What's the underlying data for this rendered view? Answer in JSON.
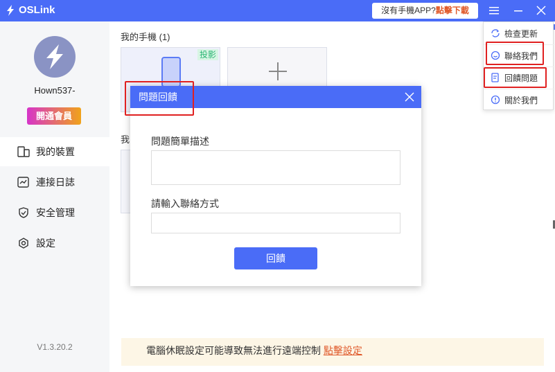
{
  "titlebar": {
    "app_name": "OSLink",
    "download_prompt": "沒有手機APP?",
    "download_link": "點擊下載"
  },
  "sidebar": {
    "username": "Hown537-",
    "vip_label": "開通會員",
    "items": [
      {
        "label": "我的裝置",
        "icon": "device-icon"
      },
      {
        "label": "連接日誌",
        "icon": "log-icon"
      },
      {
        "label": "安全管理",
        "icon": "shield-icon"
      },
      {
        "label": "設定",
        "icon": "gear-icon"
      }
    ],
    "version": "V1.3.20.2"
  },
  "main": {
    "my_phones_title": "我的手機 (1)",
    "cast_tag": "投影",
    "second_title_partial": "我",
    "notice_text": "電腦休眠設定可能導致無法進行遠端控制",
    "notice_link": "點擊設定"
  },
  "menu": {
    "items": [
      {
        "label": "檢查更新",
        "icon": "refresh-icon"
      },
      {
        "label": "聯絡我們",
        "icon": "chat-icon"
      },
      {
        "label": "回饋問題",
        "icon": "feedback-icon"
      },
      {
        "label": "關於我們",
        "icon": "info-icon"
      }
    ]
  },
  "dialog": {
    "title": "問題回饋",
    "description_label": "問題簡單描述",
    "description_value": "",
    "contact_label": "請輸入聯絡方式",
    "contact_value": "",
    "submit_label": "回饋"
  },
  "colors": {
    "brand_blue": "#4a6cf7",
    "highlight_red": "#e02020",
    "link_orange": "#e0592a"
  }
}
